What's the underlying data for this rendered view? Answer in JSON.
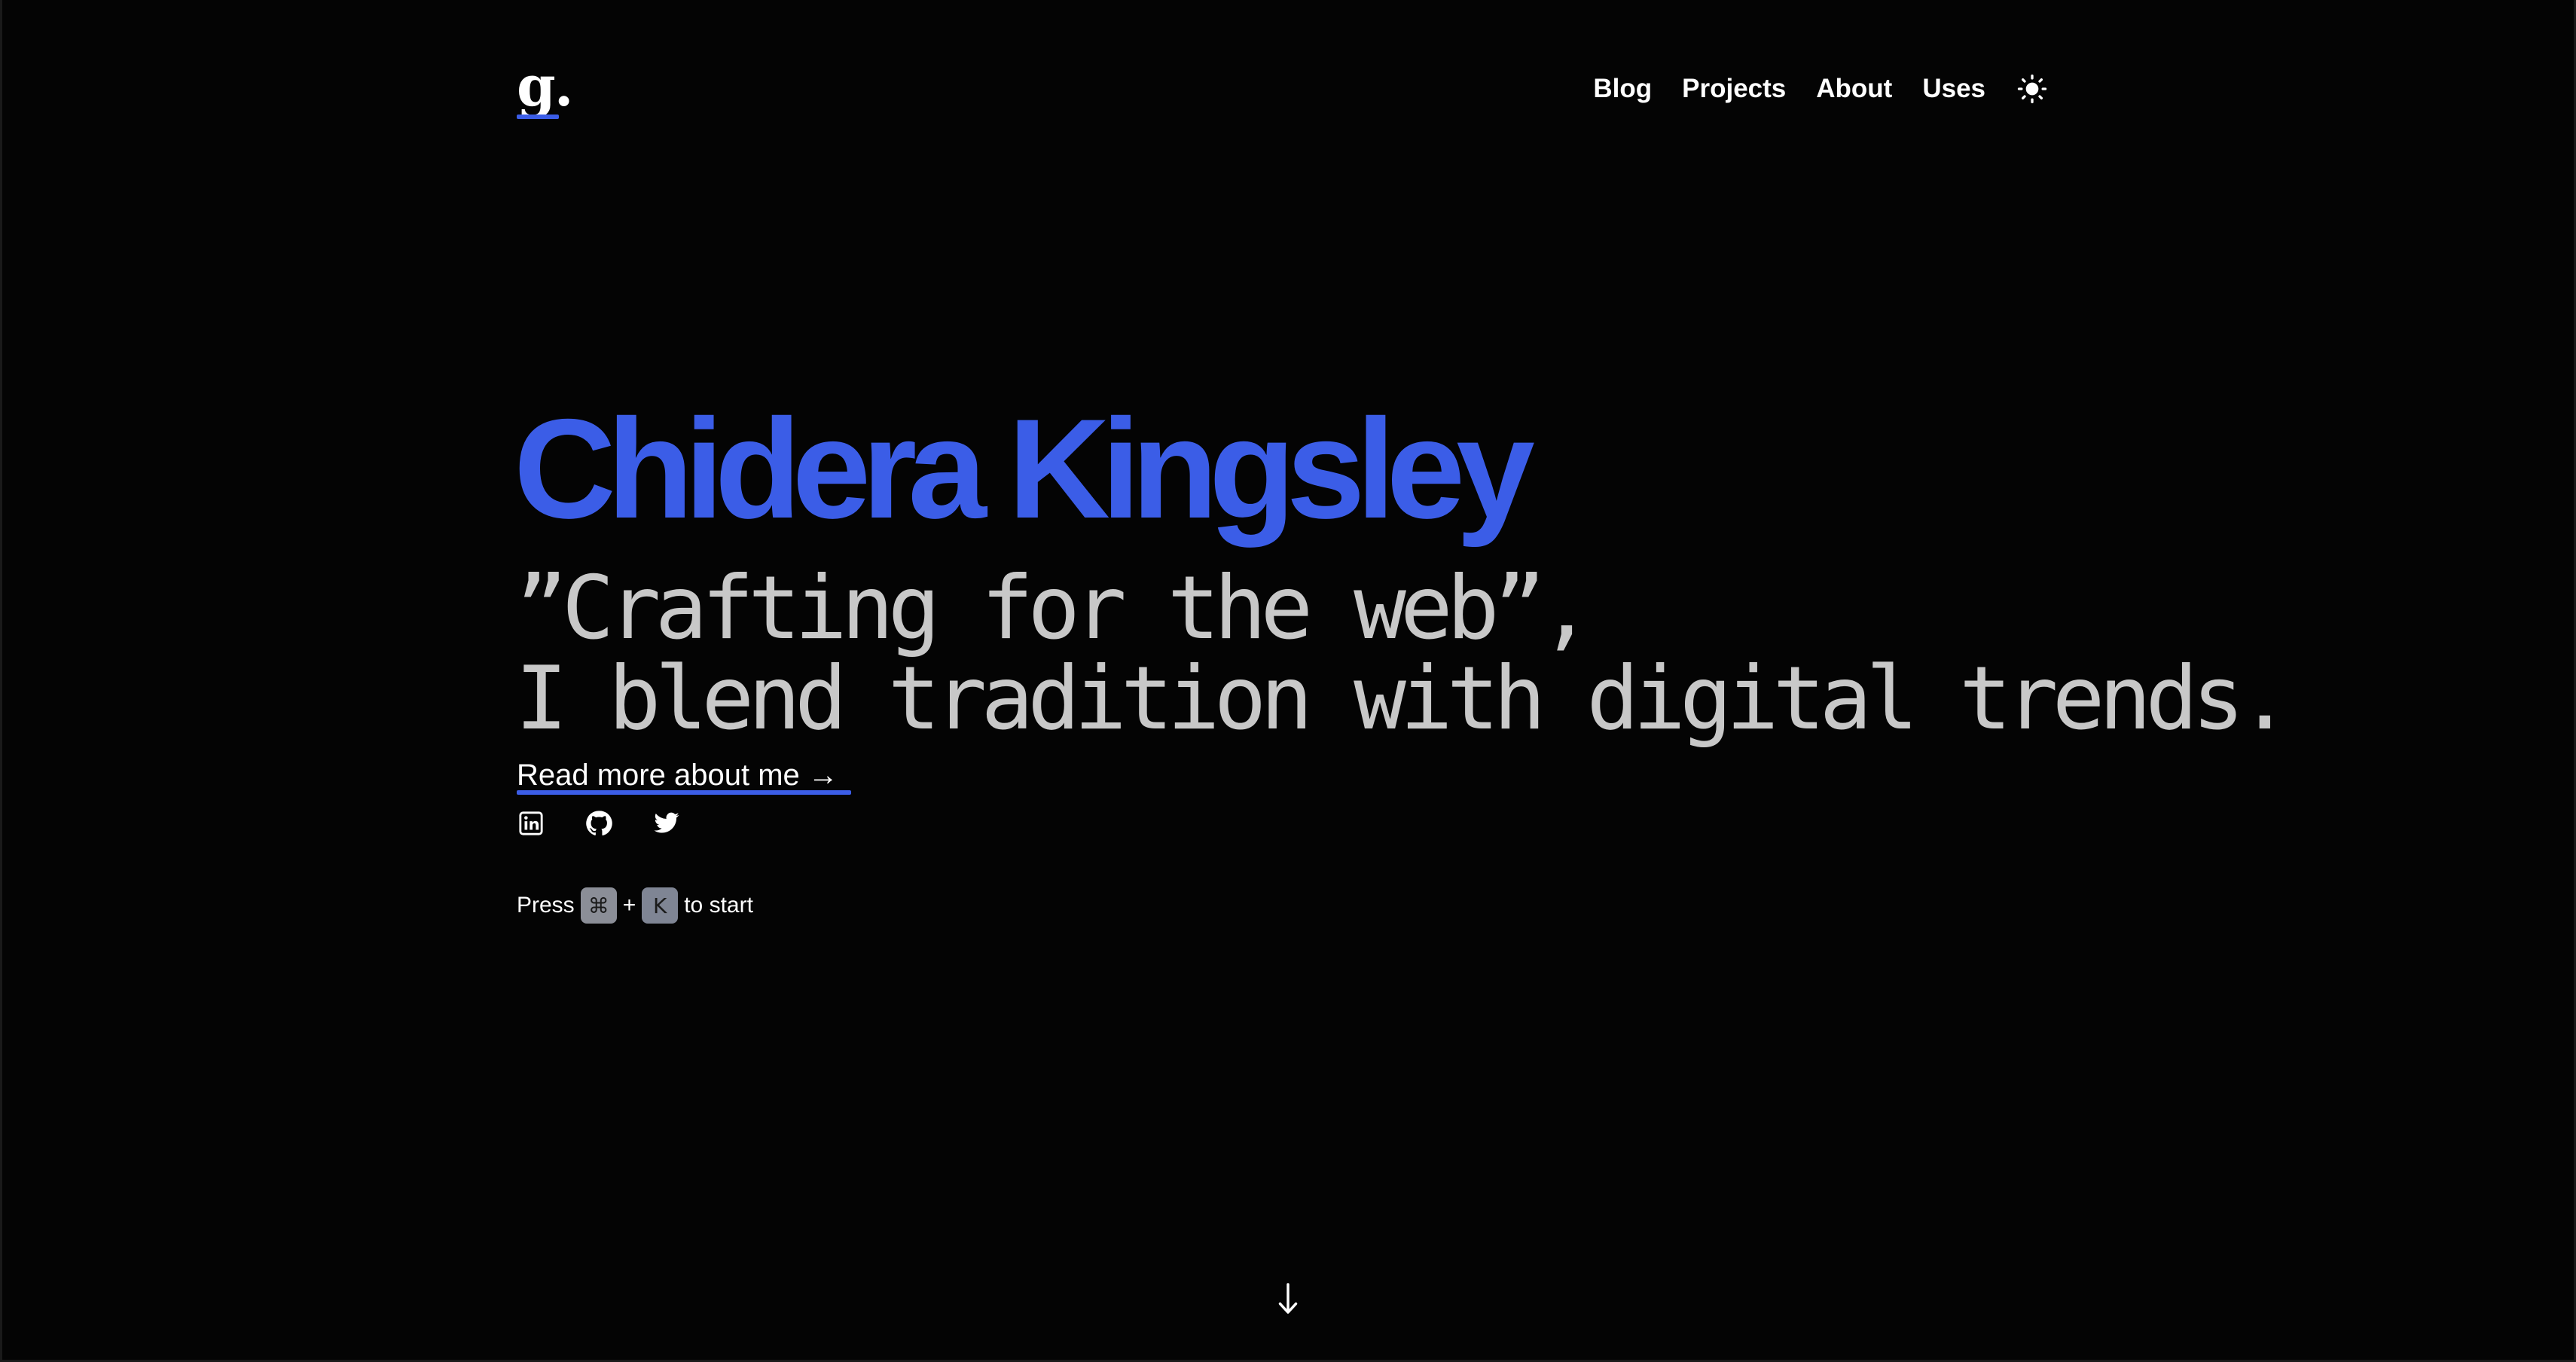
{
  "header": {
    "logo_text": "g.",
    "nav": [
      {
        "label": "Blog"
      },
      {
        "label": "Projects"
      },
      {
        "label": "About"
      },
      {
        "label": "Uses"
      }
    ],
    "theme_toggle_icon": "sun-icon"
  },
  "hero": {
    "name": "Chidera Kingsley",
    "tagline_line1": "”Crafting for the web”,",
    "tagline_line2": "I blend tradition with digital trends.",
    "read_more_label": "Read more about me →"
  },
  "socials": [
    {
      "icon": "linkedin-icon"
    },
    {
      "icon": "github-icon"
    },
    {
      "icon": "twitter-icon"
    }
  ],
  "shortcut": {
    "prefix": "Press",
    "key1": "⌘",
    "joiner": "+",
    "key2": "K",
    "suffix": "to start"
  },
  "scroll_icon": "arrow-down-icon",
  "colors": {
    "background": "#040404",
    "accent": "#3b5de7",
    "tagline": "#c8c8c8",
    "text": "#ffffff"
  }
}
